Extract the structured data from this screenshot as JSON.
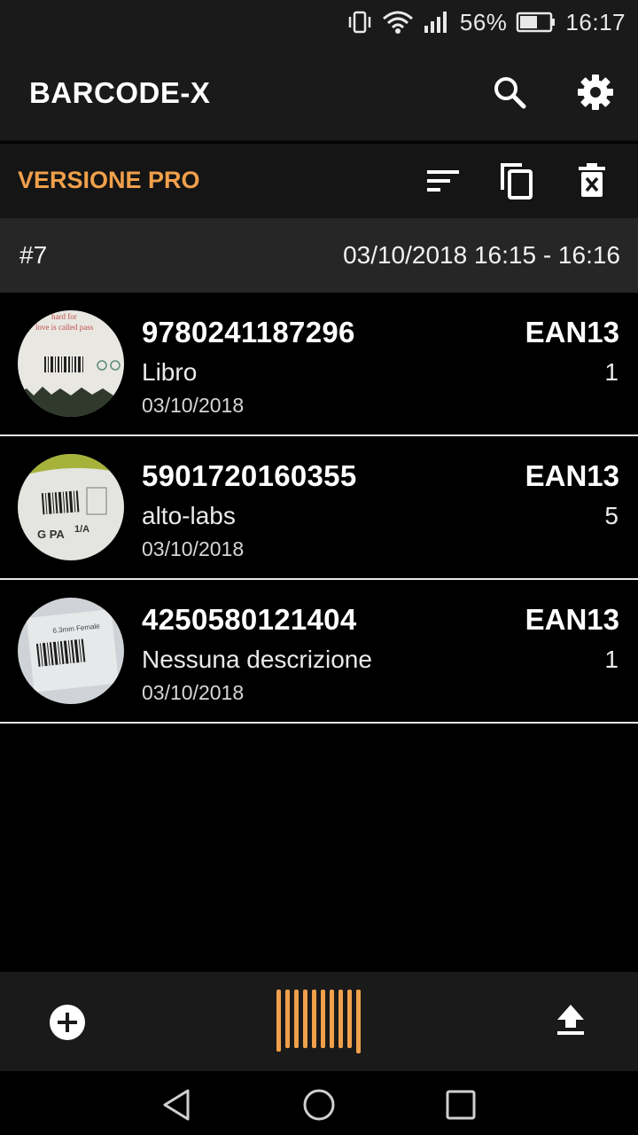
{
  "status_bar": {
    "battery": "56%",
    "time": "16:17"
  },
  "app_bar": {
    "title": "BARCODE-X",
    "icons": [
      "search-icon",
      "settings-icon"
    ]
  },
  "toolbar": {
    "pro_label": "VERSIONE PRO",
    "accent_color": "#f0a04b",
    "icons": [
      "sort-icon",
      "copy-icon",
      "delete-icon"
    ]
  },
  "session": {
    "id": "#7",
    "range": "03/10/2018 16:15 - 16:16"
  },
  "items": [
    {
      "code": "9780241187296",
      "description": "Libro",
      "date": "03/10/2018",
      "type": "EAN13",
      "quantity": "1"
    },
    {
      "code": "5901720160355",
      "description": "alto-labs",
      "date": "03/10/2018",
      "type": "EAN13",
      "quantity": "5"
    },
    {
      "code": "4250580121404",
      "description": "Nessuna descrizione",
      "date": "03/10/2018",
      "type": "EAN13",
      "quantity": "1"
    }
  ],
  "bottom_bar": {
    "icons": [
      "add-icon",
      "barcode-scan-icon",
      "upload-icon"
    ]
  },
  "nav_bar": {
    "icons": [
      "back-icon",
      "home-icon",
      "recents-icon"
    ]
  }
}
